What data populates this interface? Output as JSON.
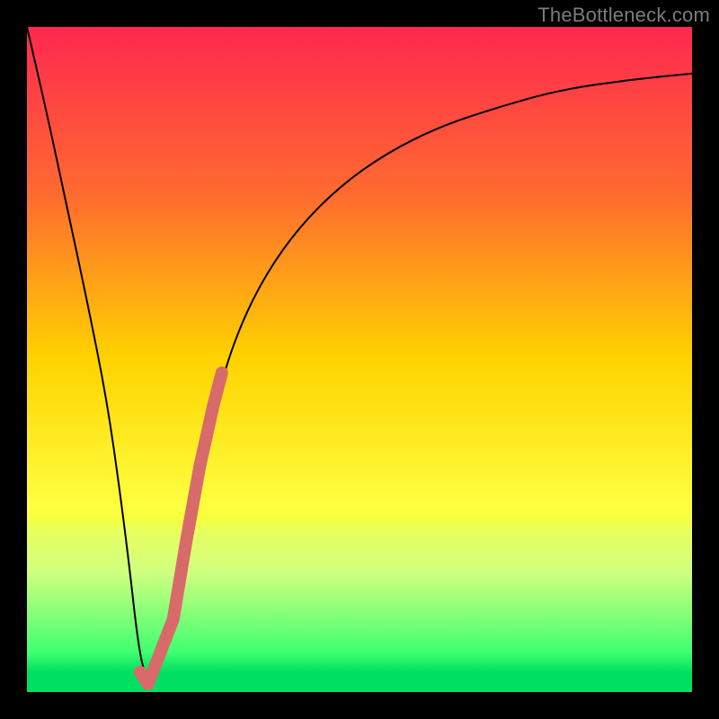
{
  "watermark": "TheBottleneck.com",
  "chart_data": {
    "type": "line",
    "title": "",
    "xlabel": "",
    "ylabel": "",
    "xlim": [
      0,
      100
    ],
    "ylim": [
      0,
      100
    ],
    "grid": false,
    "legend": false,
    "background_gradient": {
      "from": "#ff2850",
      "mid": "#ffd300",
      "to": "#00e060",
      "bands": [
        {
          "stop": 0.0,
          "color": "#ff2850"
        },
        {
          "stop": 0.25,
          "color": "#ff6a30"
        },
        {
          "stop": 0.5,
          "color": "#ffd300"
        },
        {
          "stop": 0.72,
          "color": "#ffff40"
        },
        {
          "stop": 0.74,
          "color": "#f6ff40"
        },
        {
          "stop": 0.76,
          "color": "#e8ff60"
        },
        {
          "stop": 0.82,
          "color": "#d0ff80"
        },
        {
          "stop": 0.94,
          "color": "#40ff70"
        },
        {
          "stop": 0.97,
          "color": "#00e060"
        }
      ]
    },
    "series": [
      {
        "name": "bottleneck-curve",
        "color": "#000000",
        "width": 2,
        "x": [
          0,
          3,
          6,
          9,
          12,
          14,
          15.5,
          16.5,
          17.5,
          19,
          21,
          23,
          25,
          27,
          29,
          32,
          36,
          41,
          47,
          54,
          62,
          71,
          80,
          90,
          100
        ],
        "y": [
          100,
          87,
          73,
          59,
          44,
          30,
          18,
          9,
          3,
          1,
          7,
          18,
          29,
          38,
          46,
          55,
          63,
          70,
          76,
          81,
          85,
          88,
          90.5,
          92,
          93
        ]
      },
      {
        "name": "highlight-segment",
        "color": "#d86a6a",
        "width": 14,
        "cap": "round",
        "x": [
          17.0,
          18.2,
          22.0,
          24.0,
          26.0,
          28.0,
          29.3
        ],
        "y": [
          3.0,
          1.2,
          11.0,
          23.0,
          34.0,
          43.0,
          48.0
        ]
      }
    ]
  }
}
